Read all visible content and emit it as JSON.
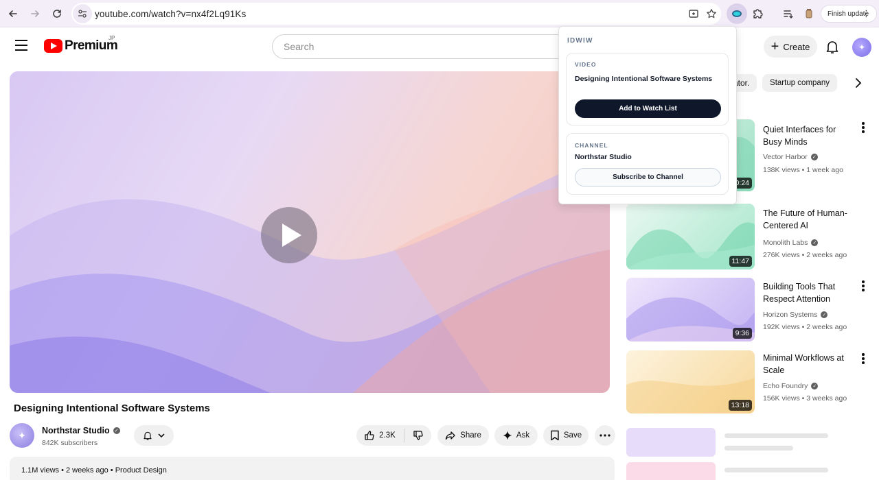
{
  "browser": {
    "url": "youtube.com/watch?v=nx4f2Lq91Ks",
    "finish_update_label": "Finish update"
  },
  "header": {
    "logo_text": "Premium",
    "logo_region": "JP",
    "search_placeholder": "Search",
    "create_label": "Create"
  },
  "chips": {
    "partial_label": "ator.",
    "startup_label": "Startup company"
  },
  "video": {
    "title": "Designing Intentional Software Systems",
    "channel_name": "Northstar Studio",
    "subscribers": "842K subscribers",
    "likes": "2.3K",
    "share_label": "Share",
    "ask_label": "Ask",
    "save_label": "Save",
    "description_meta": "1.1M views  •  2 weeks ago  •  Product Design"
  },
  "recommendations": [
    {
      "title": "Quiet Interfaces for Busy Minds",
      "channel": "Vector Harbor",
      "meta": "138K views • 1 week ago",
      "duration": "10:24",
      "color_a": "#d6f3e8",
      "color_b": "#8fdcc0"
    },
    {
      "title": "The Future of Human-Centered AI",
      "channel": "Monolith Labs",
      "meta": "276K views • 2 weeks ago",
      "duration": "11:47",
      "color_a": "#e3f7ef",
      "color_b": "#7ed9b7"
    },
    {
      "title": "Building Tools That Respect Attention",
      "channel": "Horizon Systems",
      "meta": "192K views • 2 weeks ago",
      "duration": "9:36",
      "color_a": "#ece3fb",
      "color_b": "#b4a2ee"
    },
    {
      "title": "Minimal Workflows at Scale",
      "channel": "Echo Foundry",
      "meta": "156K views • 3 weeks ago",
      "duration": "13:18",
      "color_a": "#fdf0d8",
      "color_b": "#f6d08f"
    }
  ],
  "popup": {
    "brand": "IDWIW",
    "video_label": "VIDEO",
    "video_title": "Designing Intentional Software Systems",
    "watchlist_button": "Add to Watch List",
    "channel_label": "CHANNEL",
    "channel_name": "Northstar Studio",
    "subscribe_button": "Subscribe to Channel"
  },
  "colors": {
    "brand_red": "#ff0000",
    "popup_dark_button": "#0f172a",
    "player_gradient_start": "#d8c8f3",
    "player_gradient_end": "#f7c4b8"
  }
}
